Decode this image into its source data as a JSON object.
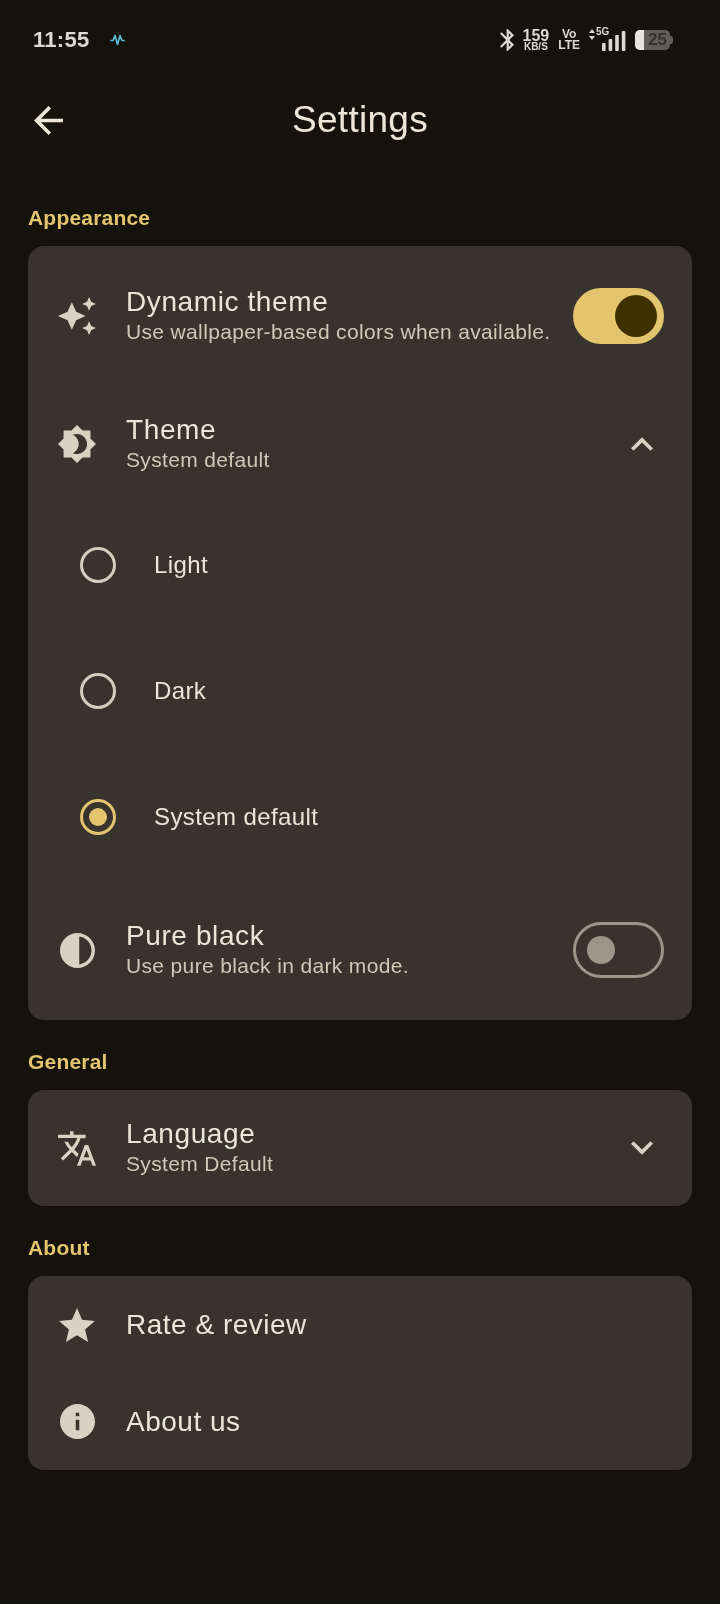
{
  "status_bar": {
    "time": "11:55",
    "speed_value": "159",
    "speed_unit": "KB/S",
    "volte_top": "Vo",
    "volte_bottom": "LTE",
    "network": "5G",
    "battery": "25"
  },
  "app_bar": {
    "title": "Settings"
  },
  "sections": [
    {
      "title": "Appearance",
      "items": [
        {
          "kind": "switch",
          "title": "Dynamic theme",
          "subtitle": "Use wallpaper-based colors when available.",
          "on": true
        },
        {
          "kind": "choice",
          "title": "Theme",
          "subtitle": "System default",
          "expanded": true,
          "options": [
            {
              "label": "Light",
              "selected": false
            },
            {
              "label": "Dark",
              "selected": false
            },
            {
              "label": "System default",
              "selected": true
            }
          ]
        },
        {
          "kind": "switch",
          "title": "Pure black",
          "subtitle": "Use pure black in dark mode.",
          "on": false
        }
      ]
    },
    {
      "title": "General",
      "items": [
        {
          "kind": "choice",
          "title": "Language",
          "subtitle": "System Default",
          "expanded": false
        }
      ]
    },
    {
      "title": "About",
      "items": [
        {
          "kind": "link",
          "title": "Rate & review"
        },
        {
          "kind": "link",
          "title": "About us"
        }
      ]
    }
  ]
}
